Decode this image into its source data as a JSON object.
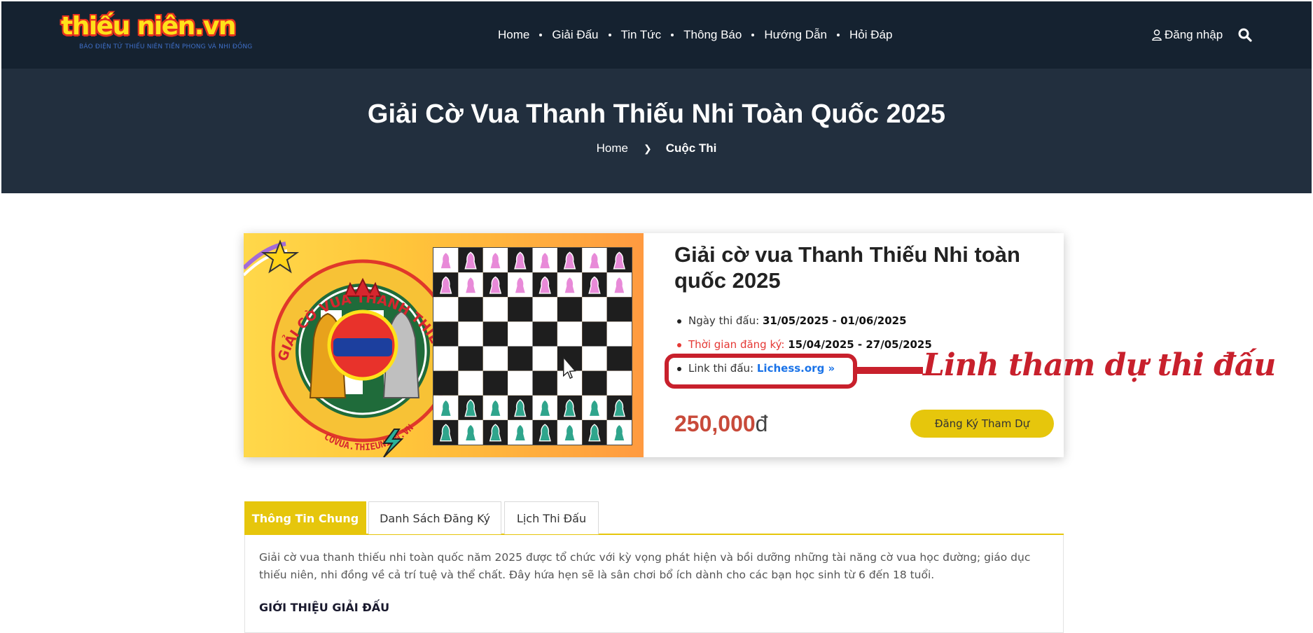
{
  "header": {
    "logo_text": "thiếu niên.vn",
    "logo_tagline": "BÁO ĐIỆN TỬ THIẾU NIÊN TIỀN PHONG VÀ NHI ĐỒNG",
    "nav": [
      "Home",
      "Giải Đấu",
      "Tin Tức",
      "Thông Báo",
      "Hướng Dẫn",
      "Hỏi Đáp"
    ],
    "login_label": "Đăng nhập",
    "icons": {
      "login": "user-icon",
      "search": "search-icon"
    }
  },
  "hero": {
    "title": "Giải Cờ Vua Thanh Thiếu Nhi Toàn Quốc 2025",
    "breadcrumb_home": "Home",
    "breadcrumb_current": "Cuộc Thi"
  },
  "event": {
    "banner_text": "GIẢI CỜ VUA THANH THIẾU NHI TOÀN QUỐC",
    "banner_site": "COVUA.THIEUNIEN.VN",
    "title": "Giải cờ vua Thanh Thiếu Nhi toàn quốc 2025",
    "date_label": "Ngày thi đấu:",
    "date_value": "31/05/2025 - 01/06/2025",
    "reg_label": "Thời gian đăng ký:",
    "reg_value": "15/04/2025 - 27/05/2025",
    "link_label": "Link thi đấu:",
    "link_text": "Lichess.org »",
    "price": "250,000",
    "currency": "đ",
    "register_button": "Đăng Ký Tham Dự",
    "annotation": "Linh tham dự thi đấu"
  },
  "colors": {
    "nav_bg": "#152230",
    "hero_bg": "#222f3e",
    "accent_yellow": "#e6c60c",
    "price_red": "#c84a3a",
    "annotation_red": "#c8202c",
    "link_blue": "#1a73e8"
  },
  "tabs": [
    {
      "label": "Thông Tin Chung",
      "active": true
    },
    {
      "label": "Danh Sách Đăng Ký",
      "active": false
    },
    {
      "label": "Lịch Thi Đấu",
      "active": false
    }
  ],
  "content": {
    "description": "Giải cờ vua thanh thiếu nhi toàn quốc năm 2025 được tổ chức với kỳ vọng phát hiện và bồi dưỡng những tài năng cờ vua học đường; giáo dục thiếu niên, nhi đồng về cả trí tuệ và thể chất. Đây hứa hẹn sẽ là sân chơi bổ ích dành cho các bạn học sinh từ 6 đến 18 tuổi.",
    "section_heading": "GIỚI THIỆU GIẢI ĐẤU"
  }
}
